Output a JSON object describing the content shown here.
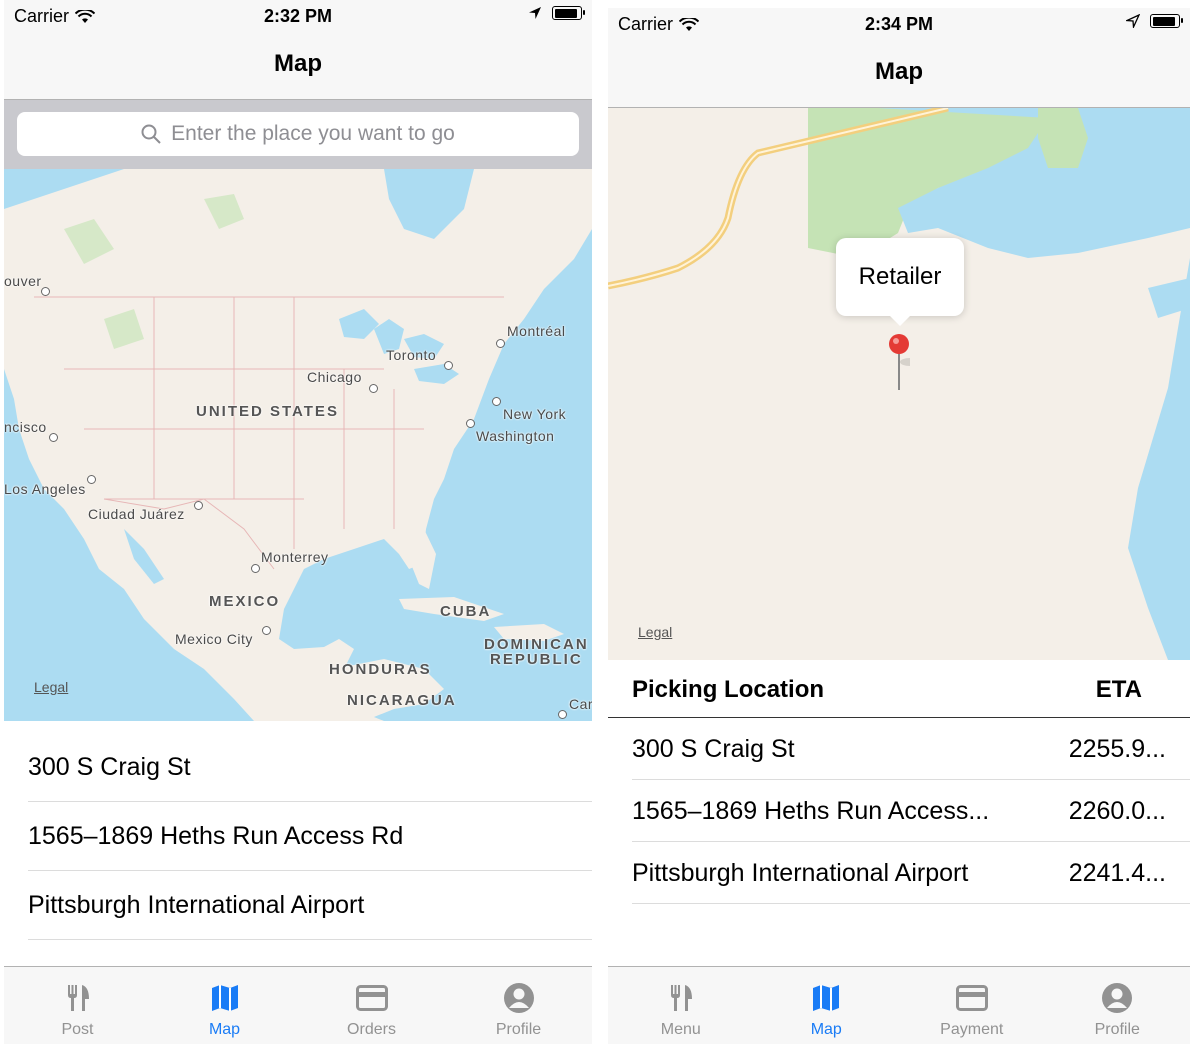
{
  "left": {
    "status": {
      "carrier": "Carrier",
      "time": "2:32 PM"
    },
    "nav": {
      "title": "Map"
    },
    "search": {
      "placeholder": "Enter the place you want to go"
    },
    "map": {
      "labels": {
        "vancouver": "ouver",
        "montreal": "Montréal",
        "toronto": "Toronto",
        "chicago": "Chicago",
        "united_states": "UNITED STATES",
        "new_york": "New York",
        "washington": "Washington",
        "san_francisco": "ncisco",
        "los_angeles": "Los Angeles",
        "ciudad_juarez": "Ciudad Juárez",
        "monterrey": "Monterrey",
        "mexico": "MEXICO",
        "cuba": "CUBA",
        "dominican_republic_1": "DOMINICAN",
        "dominican_republic_2": "REPUBLIC",
        "mexico_city": "Mexico City",
        "honduras": "HONDURAS",
        "nicaragua": "NICARAGUA",
        "car": "Car"
      },
      "legal": "Legal"
    },
    "places": [
      "300 S Craig St",
      "1565–1869 Heths Run Access Rd",
      "Pittsburgh International Airport"
    ],
    "tabs": [
      {
        "label": "Post",
        "icon": "fork-knife-icon"
      },
      {
        "label": "Map",
        "icon": "map-icon",
        "active": true
      },
      {
        "label": "Orders",
        "icon": "card-icon"
      },
      {
        "label": "Profile",
        "icon": "person-icon"
      }
    ]
  },
  "right": {
    "status": {
      "carrier": "Carrier",
      "time": "2:34 PM"
    },
    "nav": {
      "title": "Map"
    },
    "map": {
      "callout": "Retailer",
      "legal": "Legal"
    },
    "table": {
      "header_location": "Picking Location",
      "header_eta": "ETA",
      "rows": [
        {
          "location": "300 S Craig St",
          "eta": "2255.9..."
        },
        {
          "location": "1565–1869 Heths Run Access...",
          "eta": "2260.0..."
        },
        {
          "location": "Pittsburgh International Airport",
          "eta": "2241.4..."
        }
      ]
    },
    "tabs": [
      {
        "label": "Menu",
        "icon": "fork-knife-icon"
      },
      {
        "label": "Map",
        "icon": "map-icon",
        "active": true
      },
      {
        "label": "Payment",
        "icon": "card-icon"
      },
      {
        "label": "Profile",
        "icon": "person-icon"
      }
    ]
  },
  "colors": {
    "accent": "#1a7cf6",
    "water": "#acdcf2",
    "land": "#f4efe8",
    "park": "#c5e3b5",
    "road": "#f3cf7e"
  }
}
